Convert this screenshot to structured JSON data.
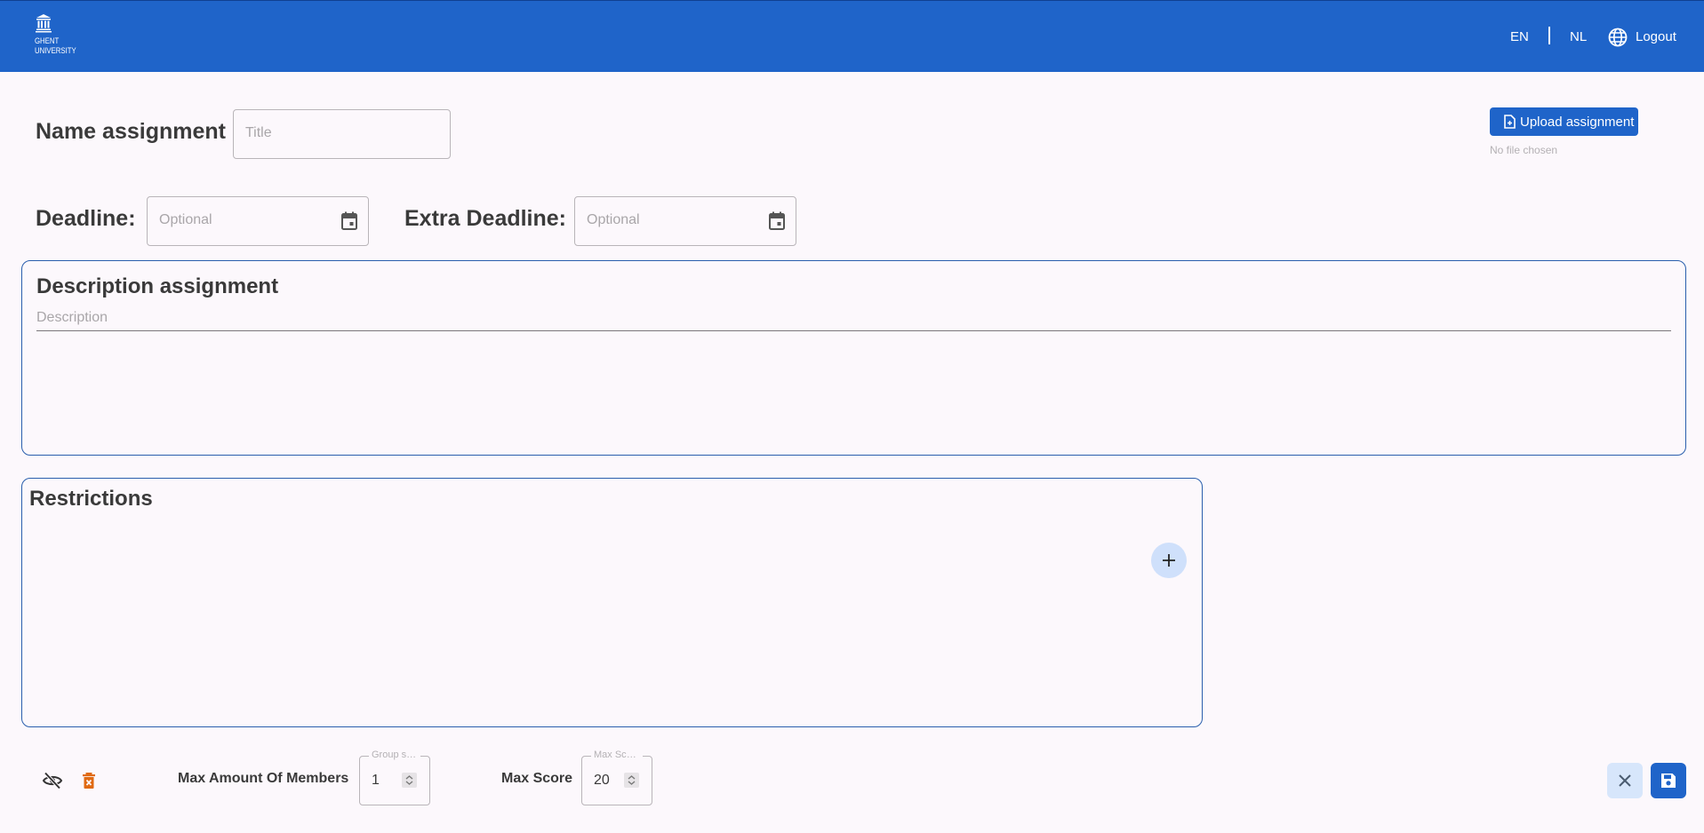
{
  "header": {
    "logo_text": "GHENT\nUNIVERSITY",
    "lang_en": "EN",
    "lang_nl": "NL",
    "logout": "Logout",
    "logo_icon": "building-icon",
    "language_icon": "globe-icon"
  },
  "form": {
    "name_label": "Name assignment",
    "title_placeholder": "Title",
    "deadline_label": "Deadline:",
    "deadline_placeholder": "Optional",
    "extra_deadline_label": "Extra Deadline:",
    "extra_deadline_placeholder": "Optional",
    "upload_label": "Upload assignment",
    "no_file": "No file chosen"
  },
  "description": {
    "title": "Description assignment",
    "placeholder": "Description"
  },
  "restrictions": {
    "title": "Restrictions"
  },
  "footer": {
    "max_members_label": "Max Amount Of Members",
    "max_members_legend": "Group size",
    "max_members_value": "1",
    "max_score_label": "Max Score",
    "max_score_legend": "Max Score",
    "max_score_value": "20"
  },
  "colors": {
    "primary": "#1f64c9",
    "delete_icon": "#e06a12"
  }
}
